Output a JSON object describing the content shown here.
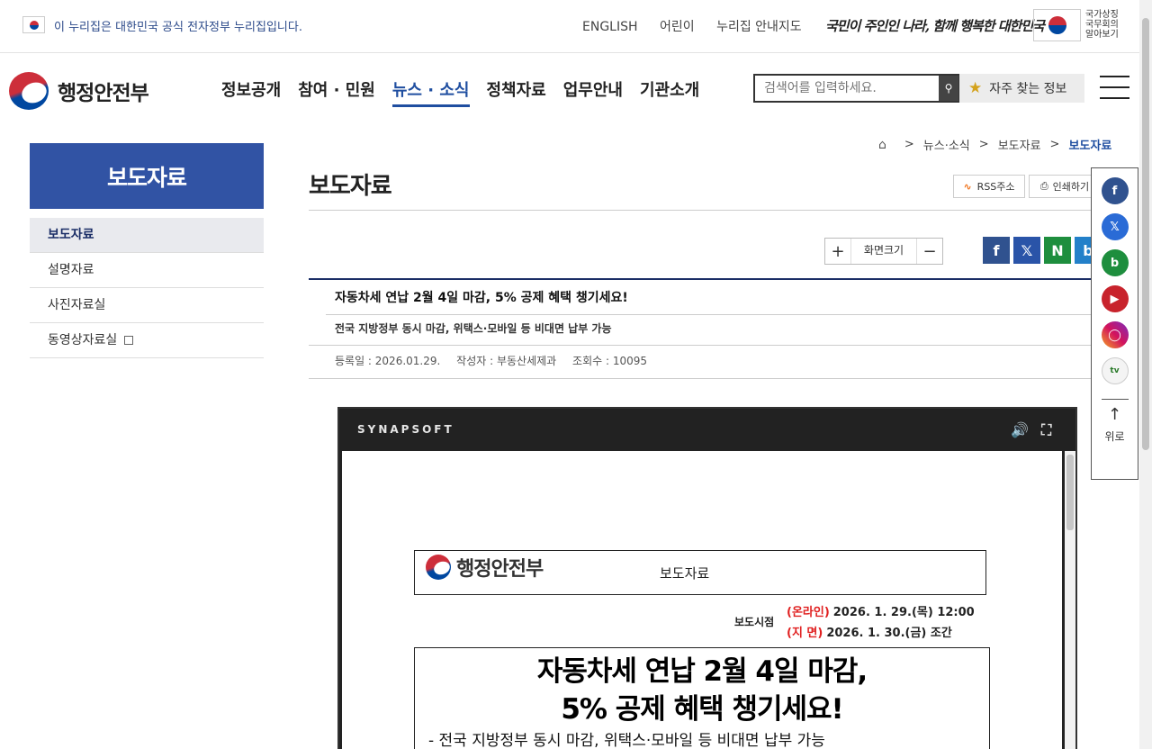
{
  "govbar": {
    "notice": "이 누리집은 대한민국 공식 전자정부 누리집입니다.",
    "links": [
      "ENGLISH",
      "어린이",
      "누리집 안내지도"
    ],
    "slogan": "국민이 주인인 나라, 함께 행복한 대한민국",
    "national_symbol": [
      "국가상징",
      "국무회의",
      "알아보기"
    ]
  },
  "header": {
    "logo": "행정안전부",
    "nav": [
      "정보공개",
      "참여 · 민원",
      "뉴스 · 소식",
      "정책자료",
      "업무안내",
      "기관소개"
    ],
    "active_nav": "뉴스 · 소식",
    "search_placeholder": "검색어를 입력하세요.",
    "favorite_label": "자주 찾는 정보"
  },
  "lnb": {
    "title": "보도자료",
    "items": [
      "보도자료",
      "설명자료",
      "사진자료실",
      "동영상자료실"
    ]
  },
  "breadcrumb": [
    "뉴스·소식",
    "보도자료",
    "보도자료"
  ],
  "page": {
    "title": "보도자료",
    "rss_label": "RSS주소",
    "print_label": "인쇄하기",
    "zoom_label": "화면크기"
  },
  "article": {
    "title": "자동차세 연납 2월 4일 마감, 5% 공제 혜택 챙기세요!",
    "subtitle": "전국 지방정부 동시 마감, 위택스·모바일 등 비대면 납부 가능",
    "meta": [
      "등록일 : 2026.01.29.",
      "작성자 : 부동산세제과",
      "조회수 : 10095"
    ]
  },
  "viewer": {
    "brand": "SYNAPSOFT",
    "doc_logo": "행정안전부",
    "doc_kind": "보도자료",
    "time_label": "보도시점",
    "times": [
      {
        "tag": "(온라인)",
        "value": "2026. 1. 29.(목) 12:00"
      },
      {
        "tag": "(지  면)",
        "value": "2026. 1. 30.(금) 조간"
      }
    ],
    "headline1": "자동차세 연납 2월 4일 마감,",
    "headline2": "5% 공제 혜택 챙기세요!",
    "bullet": "- 전국 지방정부 동시 마감, 위택스·모바일 등 비대면 납부 가능"
  },
  "quick": {
    "up_label": "위로"
  },
  "colors": {
    "accent": "#1f4ea0",
    "lnb_title_bg": "#3153a4",
    "red": "#e02020"
  }
}
